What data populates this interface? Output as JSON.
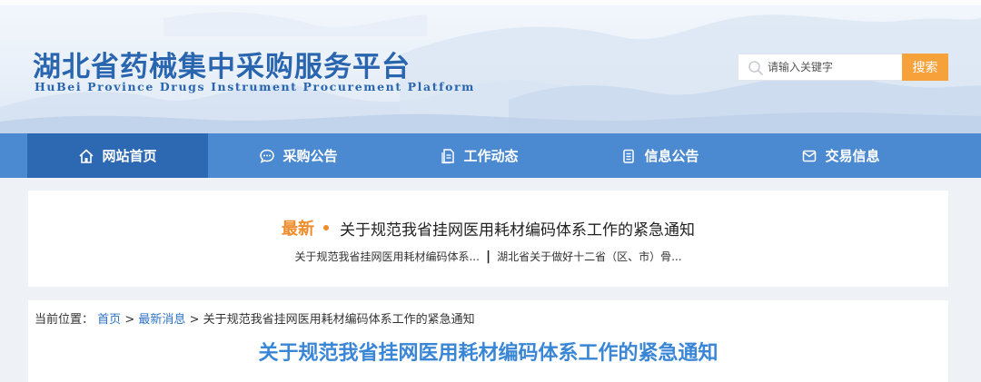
{
  "header": {
    "title_cn": "湖北省药械集中采购服务平台",
    "title_en": "HuBei Province Drugs Instrument Procurement Platform",
    "search": {
      "placeholder": "请输入关键字",
      "button_label": "搜索",
      "icon": "search-icon"
    }
  },
  "nav": {
    "items": [
      {
        "label": "网站首页",
        "icon": "home-icon",
        "active": true
      },
      {
        "label": "采购公告",
        "icon": "chat-bubble-icon",
        "active": false
      },
      {
        "label": "工作动态",
        "icon": "document-icon",
        "active": false
      },
      {
        "label": "信息公告",
        "icon": "list-document-icon",
        "active": false
      },
      {
        "label": "交易信息",
        "icon": "envelope-icon",
        "active": false
      }
    ]
  },
  "latest": {
    "tag": "最新",
    "headline": "关于规范我省挂网医用耗材编码体系工作的紧急通知",
    "links": [
      "关于规范我省挂网医用耗材编码体系...",
      "湖北省关于做好十二省（区、市）骨..."
    ],
    "separator": "|"
  },
  "article": {
    "breadcrumb": {
      "prefix": "当前位置：",
      "home": "首页",
      "sep1": " >",
      "category": "最新消息",
      "sep2": ">",
      "current": "关于规范我省挂网医用耗材编码体系工作的紧急通知"
    },
    "title": "关于规范我省挂网医用耗材编码体系工作的紧急通知"
  },
  "colors": {
    "brand_blue": "#2a66b0",
    "nav_bg": "#4b8ad1",
    "nav_active": "#2d68b3",
    "accent_orange": "#f6a13a",
    "title_blue": "#3a86d6"
  }
}
